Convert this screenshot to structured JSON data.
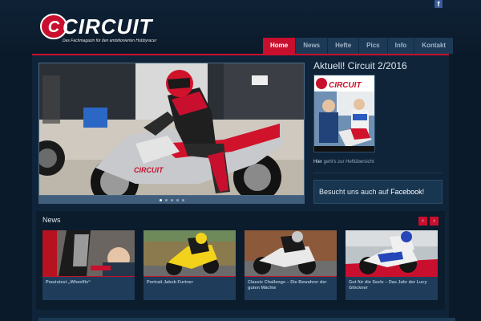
{
  "brand": {
    "logo_text": "CIRCUIT",
    "logo_letter": "C",
    "tagline": "Das Fachmagazin für den ambitionierten Hobbyracer",
    "accent": "#c8102e",
    "background": "#0b1a2a"
  },
  "social": {
    "facebook_icon": "f"
  },
  "nav": {
    "items": [
      {
        "label": "Home",
        "active": true
      },
      {
        "label": "News",
        "active": false
      },
      {
        "label": "Hefte",
        "active": false
      },
      {
        "label": "Pics",
        "active": false
      },
      {
        "label": "Info",
        "active": false
      },
      {
        "label": "Kontakt",
        "active": false
      }
    ]
  },
  "slider": {
    "slides": 5,
    "active_slide": 1
  },
  "aside": {
    "title": "Aktuell! Circuit 2/2016",
    "cover_logo": "CIRCUIT",
    "link_prefix": "Hier",
    "link_suffix": " geht's zur Heftübersicht",
    "facebook_prefix": "Besucht uns auch auf ",
    "facebook_link": "Facebook!"
  },
  "news": {
    "title": "News",
    "prev_icon": "‹",
    "next_icon": "›",
    "cards": [
      {
        "caption": "Praxistest „Wheelfix“"
      },
      {
        "caption": "Portrait Jakob Furtner"
      },
      {
        "caption": "Classic Challenge – Die Bewahrer der guten Mächte"
      },
      {
        "caption": "Gut für die Seele – Das Jahr der Lucy Glöckner"
      }
    ]
  }
}
